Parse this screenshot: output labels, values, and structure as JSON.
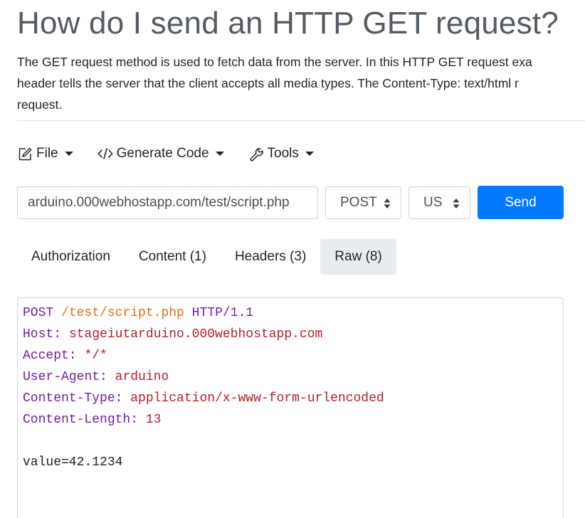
{
  "page": {
    "title": "How do I send an HTTP GET request?",
    "description_lines": [
      "The GET request method is used to fetch data from the server. In this HTTP GET request exa",
      "header tells the server that the client accepts all media types. The Content-Type: text/html r",
      "request."
    ]
  },
  "toolbar": {
    "file_label": "File",
    "generate_label": "Generate Code",
    "tools_label": "Tools",
    "file_icon": "edit-icon",
    "generate_icon": "code-icon",
    "tools_icon": "wrench-icon"
  },
  "request": {
    "url": "arduino.000webhostapp.com/test/script.php",
    "method": "POST",
    "region": "US",
    "send_label": "Send"
  },
  "tabs": [
    {
      "label": "Authorization",
      "active": false
    },
    {
      "label": "Content (1)",
      "active": false
    },
    {
      "label": "Headers (3)",
      "active": false
    },
    {
      "label": "Raw (8)",
      "active": true
    }
  ],
  "raw": {
    "method": "POST",
    "path": "/test/script.php",
    "protocol": "HTTP/1.1",
    "headers": [
      {
        "key": "Host:",
        "value": "stageiutarduino.000webhostapp.com"
      },
      {
        "key": "Accept:",
        "value": "*/*"
      },
      {
        "key": "User-Agent:",
        "value": "arduino"
      },
      {
        "key": "Content-Type:",
        "value": "application/x-www-form-urlencoded"
      },
      {
        "key": "Content-Length:",
        "value": "13"
      }
    ],
    "body": "value=42.1234"
  },
  "colors": {
    "accent": "#007bff",
    "method_key": "#6f1e9b",
    "path": "#e0701b",
    "value": "#b0222b"
  }
}
